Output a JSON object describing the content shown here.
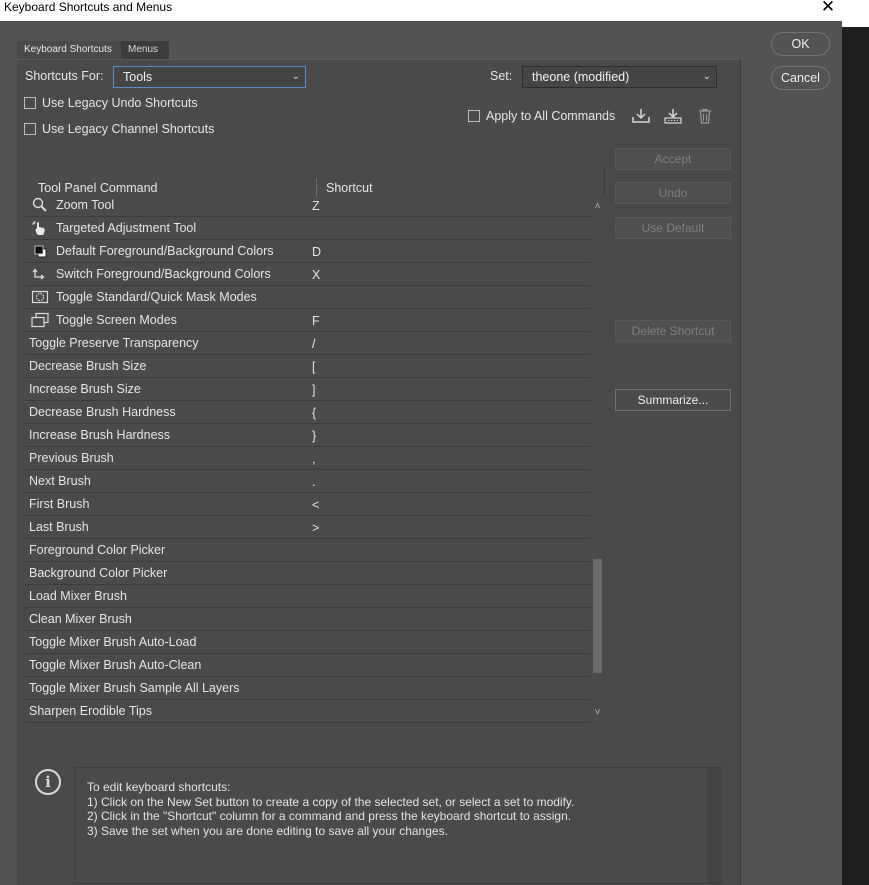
{
  "window": {
    "title": "Keyboard Shortcuts and Menus",
    "close_glyph": "✕"
  },
  "tabs": [
    {
      "label": "Keyboard Shortcuts",
      "active": true
    },
    {
      "label": "Menus",
      "active": false
    }
  ],
  "shortcuts_for": {
    "label": "Shortcuts For:",
    "value": "Tools",
    "chevron": "⌄"
  },
  "set": {
    "label": "Set:",
    "value": "theone (modified)",
    "chevron": "⌄"
  },
  "options": {
    "legacy_undo": "Use Legacy Undo Shortcuts",
    "legacy_channel": "Use Legacy Channel Shortcuts",
    "apply_all": "Apply to All Commands"
  },
  "set_icons": [
    "save-set-icon",
    "new-set-icon",
    "delete-set-icon"
  ],
  "table": {
    "col_command": "Tool Panel Command",
    "col_shortcut": "Shortcut",
    "rows": [
      {
        "command": "Zoom Tool",
        "key": "Z",
        "icon": "zoom-tool-icon"
      },
      {
        "command": "Targeted Adjustment Tool",
        "key": "",
        "icon": "targeted-adjustment-icon"
      },
      {
        "command": "Default Foreground/Background Colors",
        "key": "D",
        "icon": "default-colors-icon"
      },
      {
        "command": "Switch Foreground/Background Colors",
        "key": "X",
        "icon": "switch-colors-icon"
      },
      {
        "command": "Toggle Standard/Quick Mask Modes",
        "key": "",
        "icon": "quick-mask-icon"
      },
      {
        "command": "Toggle Screen Modes",
        "key": "F",
        "icon": "screen-modes-icon"
      },
      {
        "command": "Toggle Preserve Transparency",
        "key": "/"
      },
      {
        "command": "Decrease Brush Size",
        "key": "["
      },
      {
        "command": "Increase Brush Size",
        "key": "]"
      },
      {
        "command": "Decrease Brush Hardness",
        "key": "{"
      },
      {
        "command": "Increase Brush Hardness",
        "key": "}"
      },
      {
        "command": "Previous Brush",
        "key": ","
      },
      {
        "command": "Next Brush",
        "key": "."
      },
      {
        "command": "First Brush",
        "key": "<"
      },
      {
        "command": "Last Brush",
        "key": ">"
      },
      {
        "command": "Foreground Color Picker",
        "key": ""
      },
      {
        "command": "Background Color Picker",
        "key": ""
      },
      {
        "command": "Load Mixer Brush",
        "key": ""
      },
      {
        "command": "Clean Mixer Brush",
        "key": ""
      },
      {
        "command": "Toggle Mixer Brush Auto-Load",
        "key": ""
      },
      {
        "command": "Toggle Mixer Brush Auto-Clean",
        "key": ""
      },
      {
        "command": "Toggle Mixer Brush Sample All Layers",
        "key": ""
      },
      {
        "command": "Sharpen Erodible Tips",
        "key": ""
      }
    ]
  },
  "scrollbar": {
    "up": "˄",
    "down": "˅"
  },
  "buttons": {
    "ok": "OK",
    "cancel": "Cancel",
    "accept": "Accept",
    "undo": "Undo",
    "use_default": "Use Default",
    "delete_shortcut": "Delete Shortcut",
    "summarize": "Summarize..."
  },
  "info": {
    "icon_glyph": "i",
    "text": "To edit keyboard shortcuts:\n1) Click on the New Set button to create a copy of the selected set, or select a set to modify.\n2) Click in the \"Shortcut\" column for a command and press the keyboard shortcut to assign.\n3) Save the set when you are done editing to save all your changes."
  },
  "colors": {
    "dialog_bg": "#535353",
    "panel_bg": "#4a4a4a",
    "text": "#e6e6e6",
    "disabled_text": "#7e7e7e",
    "focus_border": "#5b8ac7"
  }
}
